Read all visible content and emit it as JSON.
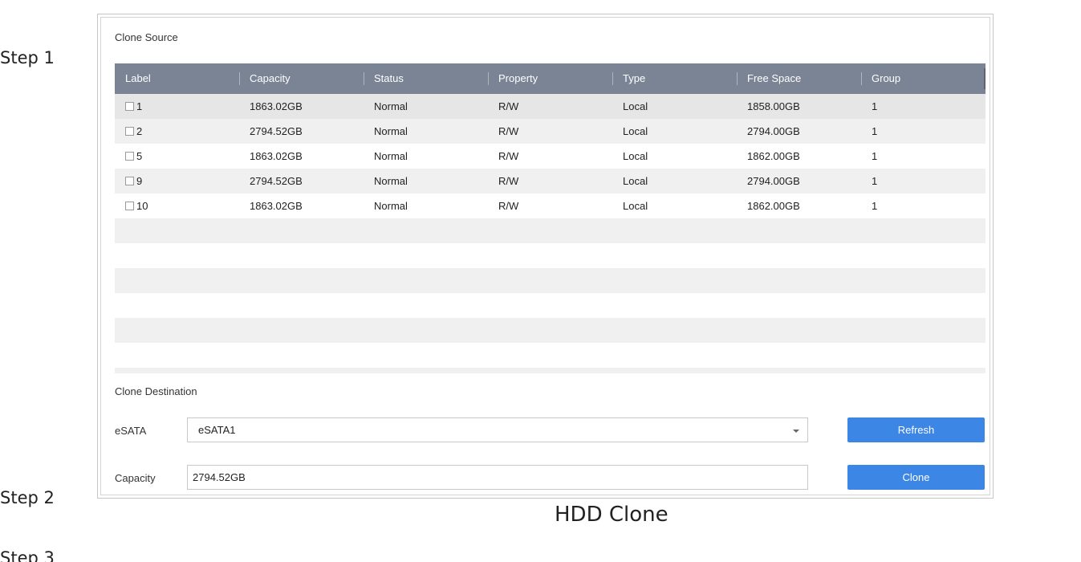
{
  "steps": {
    "step1": "Step 1",
    "step2": "Step 2",
    "step3": "Step 3"
  },
  "caption": "HDD Clone",
  "clone_source": {
    "title": "Clone Source",
    "columns": [
      "Label",
      "Capacity",
      "Status",
      "Property",
      "Type",
      "Free Space",
      "Group"
    ],
    "rows": [
      {
        "label": "1",
        "capacity": "1863.02GB",
        "status": "Normal",
        "property": "R/W",
        "type": "Local",
        "free_space": "1858.00GB",
        "group": "1"
      },
      {
        "label": "2",
        "capacity": "2794.52GB",
        "status": "Normal",
        "property": "R/W",
        "type": "Local",
        "free_space": "2794.00GB",
        "group": "1"
      },
      {
        "label": "5",
        "capacity": "1863.02GB",
        "status": "Normal",
        "property": "R/W",
        "type": "Local",
        "free_space": "1862.00GB",
        "group": "1"
      },
      {
        "label": "9",
        "capacity": "2794.52GB",
        "status": "Normal",
        "property": "R/W",
        "type": "Local",
        "free_space": "2794.00GB",
        "group": "1"
      },
      {
        "label": "10",
        "capacity": "1863.02GB",
        "status": "Normal",
        "property": "R/W",
        "type": "Local",
        "free_space": "1862.00GB",
        "group": "1"
      }
    ]
  },
  "clone_destination": {
    "title": "Clone Destination",
    "esata_label": "eSATA",
    "esata_value": "eSATA1",
    "capacity_label": "Capacity",
    "capacity_value": "2794.52GB",
    "refresh_label": "Refresh",
    "clone_label": "Clone"
  },
  "colors": {
    "header_bg": "#7b8494",
    "button_bg": "#3c86e6",
    "row_alt": "#f0f0f0"
  }
}
